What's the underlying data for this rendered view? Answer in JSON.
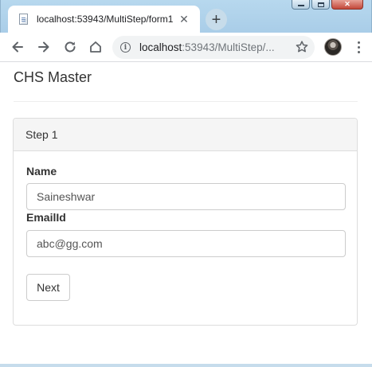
{
  "browser": {
    "tab": {
      "title": "localhost:53943/MultiStep/form1"
    },
    "address_bar": {
      "host": "localhost",
      "path": ":53943/MultiStep/..."
    }
  },
  "app": {
    "brand": "CHS Master"
  },
  "form": {
    "step_title": "Step 1",
    "name_label": "Name",
    "name_value": "Saineshwar",
    "email_label": "EmailId",
    "email_value": "abc@gg.com",
    "next_label": "Next"
  },
  "colors": {
    "panel_heading_bg": "#f5f5f5",
    "border": "#dddddd",
    "input_border": "#cccccc",
    "text": "#333333"
  }
}
